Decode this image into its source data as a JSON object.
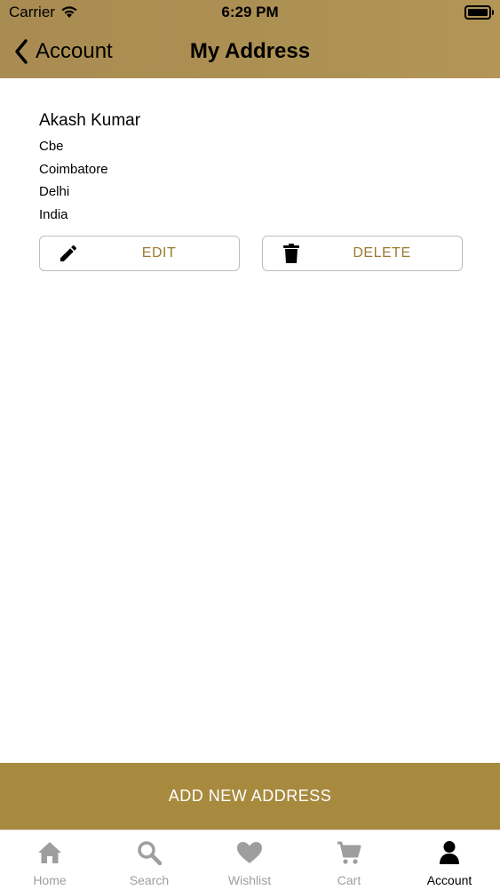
{
  "status_bar": {
    "carrier": "Carrier",
    "time": "6:29 PM"
  },
  "nav": {
    "back_label": "Account",
    "title": "My Address"
  },
  "address": {
    "name": "Akash Kumar",
    "lines": [
      "Cbe",
      "Coimbatore",
      "Delhi",
      "India"
    ],
    "edit_label": "EDIT",
    "delete_label": "DELETE"
  },
  "add_button_label": "ADD NEW ADDRESS",
  "tabs": [
    {
      "label": "Home",
      "icon": "home-icon",
      "active": false
    },
    {
      "label": "Search",
      "icon": "search-icon",
      "active": false
    },
    {
      "label": "Wishlist",
      "icon": "heart-icon",
      "active": false
    },
    {
      "label": "Cart",
      "icon": "cart-icon",
      "active": false
    },
    {
      "label": "Account",
      "icon": "user-icon",
      "active": true
    }
  ],
  "colors": {
    "header": "#ad9053",
    "accent": "#a88a3f",
    "action_text": "#9a7a2c",
    "inactive_tab": "#9e9e9e"
  }
}
